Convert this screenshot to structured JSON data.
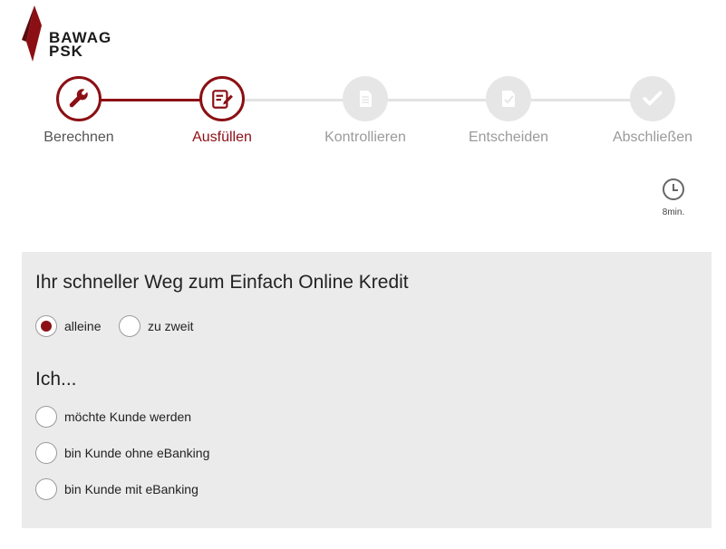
{
  "brand": {
    "line1": "BAWAG",
    "line2": "PSK",
    "color": "#8b0f14"
  },
  "steps": [
    {
      "label": "Berechnen",
      "state": "done",
      "icon": "wrench-icon"
    },
    {
      "label": "Ausfüllen",
      "state": "current",
      "icon": "edit-form-icon"
    },
    {
      "label": "Kontrollieren",
      "state": "todo",
      "icon": "document-icon"
    },
    {
      "label": "Entscheiden",
      "state": "todo",
      "icon": "document-check-icon"
    },
    {
      "label": "Abschließen",
      "state": "todo",
      "icon": "checkmark-icon"
    }
  ],
  "timer": {
    "icon": "clock-icon",
    "label": "8min."
  },
  "form": {
    "title": "Ihr schneller Weg zum Einfach Online Kredit",
    "mode_options": [
      {
        "label": "alleine",
        "checked": true
      },
      {
        "label": "zu zweit",
        "checked": false
      }
    ],
    "subtitle": "Ich...",
    "customer_options": [
      {
        "label": "möchte Kunde werden",
        "checked": false
      },
      {
        "label": "bin Kunde ohne eBanking",
        "checked": false
      },
      {
        "label": "bin Kunde mit eBanking",
        "checked": false
      }
    ]
  }
}
